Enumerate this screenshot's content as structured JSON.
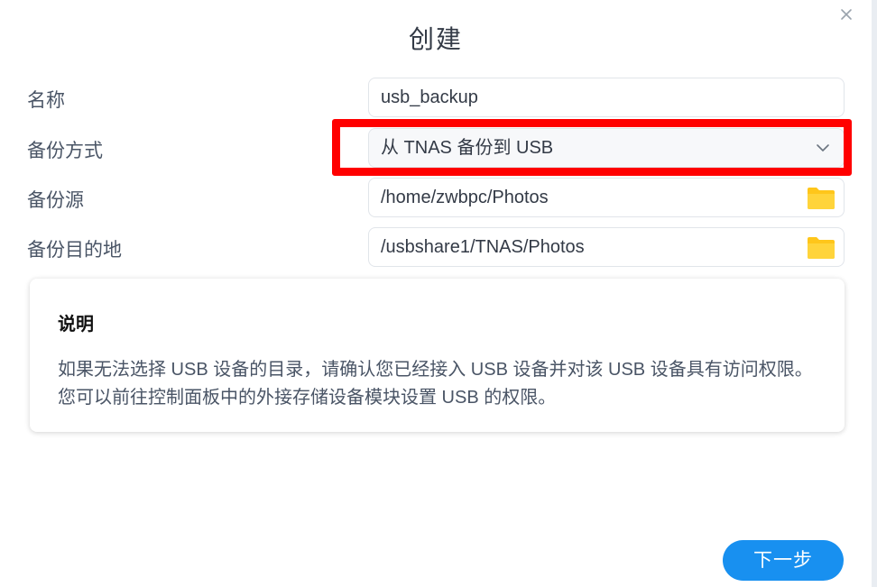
{
  "dialog": {
    "title": "创建",
    "close_icon": "close-icon"
  },
  "form": {
    "name": {
      "label": "名称",
      "value": "usb_backup"
    },
    "backup_mode": {
      "label": "备份方式",
      "value": "从 TNAS 备份到 USB",
      "icon": "chevron-down-icon"
    },
    "backup_source": {
      "label": "备份源",
      "value": "/home/zwbpc/Photos",
      "icon": "folder-icon"
    },
    "backup_destination": {
      "label": "备份目的地",
      "value": "/usbshare1/TNAS/Photos",
      "icon": "folder-icon"
    }
  },
  "info": {
    "title": "说明",
    "body": "如果无法选择 USB 设备的目录，请确认您已经接入 USB 设备并对该 USB 设备具有访问权限。您可以前往控制面板中的外接存储设备模块设置 USB 的权限。"
  },
  "footer": {
    "next_label": "下一步"
  },
  "colors": {
    "accent": "#1890f0",
    "highlight": "#ff0000",
    "folder": "#ffc61a"
  }
}
